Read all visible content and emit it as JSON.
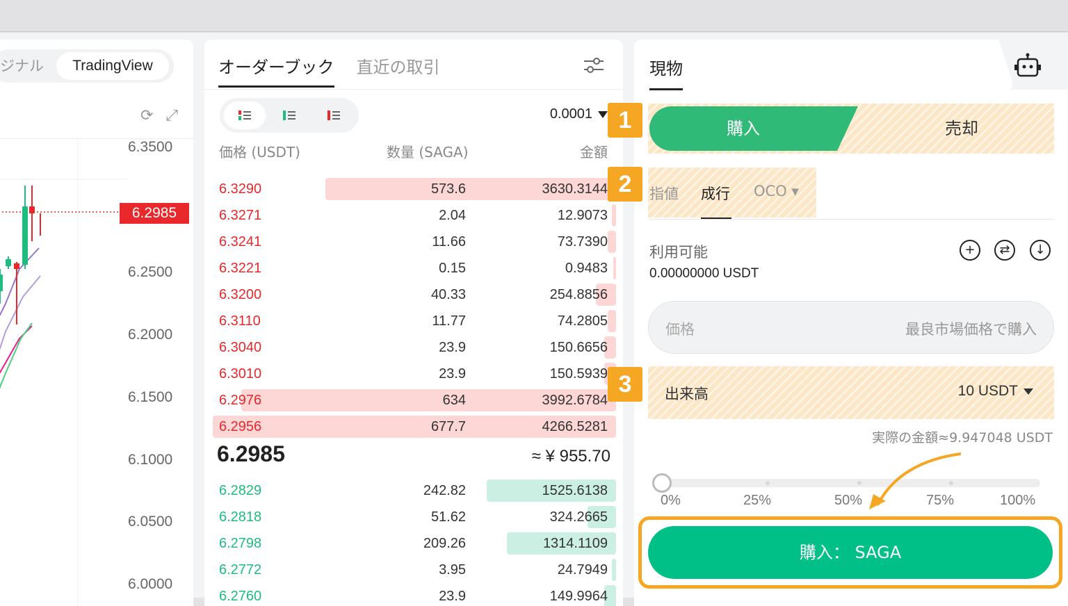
{
  "chart": {
    "view_original": "ジナル",
    "view_tradingview": "TradingView",
    "y_ticks": [
      "6.3500",
      "6.2500",
      "6.2000",
      "6.1500",
      "6.1000",
      "6.0500",
      "6.0000"
    ],
    "current_price_tag": "6.2985",
    "icons": [
      "history-icon",
      "fullscreen-icon"
    ]
  },
  "orderbook": {
    "tabs": [
      "オーダーブック",
      "直近の取引"
    ],
    "precision": "0.0001",
    "headers": {
      "price": "価格 (USDT)",
      "qty": "数量 (SAGA)",
      "amount": "金額"
    },
    "asks": [
      {
        "price": "6.3290",
        "qty": "573.6",
        "amount": "3630.3144",
        "depth": 0.72
      },
      {
        "price": "6.3271",
        "qty": "2.04",
        "amount": "12.9073",
        "depth": 0.01
      },
      {
        "price": "6.3241",
        "qty": "11.66",
        "amount": "73.7390",
        "depth": 0.02
      },
      {
        "price": "6.3221",
        "qty": "0.15",
        "amount": "0.9483",
        "depth": 0.005
      },
      {
        "price": "6.3200",
        "qty": "40.33",
        "amount": "254.8856",
        "depth": 0.05
      },
      {
        "price": "6.3110",
        "qty": "11.77",
        "amount": "74.2805",
        "depth": 0.02
      },
      {
        "price": "6.3040",
        "qty": "23.9",
        "amount": "150.6656",
        "depth": 0.03
      },
      {
        "price": "6.3010",
        "qty": "23.9",
        "amount": "150.5939",
        "depth": 0.03
      },
      {
        "price": "6.2976",
        "qty": "634",
        "amount": "3992.6784",
        "depth": 0.93
      },
      {
        "price": "6.2956",
        "qty": "677.7",
        "amount": "4266.5281",
        "depth": 1.0
      }
    ],
    "last_price": "6.2985",
    "approx_value": "≈ ¥ 955.70",
    "bids": [
      {
        "price": "6.2829",
        "qty": "242.82",
        "amount": "1525.6138",
        "depth": 0.32
      },
      {
        "price": "6.2818",
        "qty": "51.62",
        "amount": "324.2665",
        "depth": 0.07
      },
      {
        "price": "6.2798",
        "qty": "209.26",
        "amount": "1314.1109",
        "depth": 0.27
      },
      {
        "price": "6.2772",
        "qty": "3.95",
        "amount": "24.7949",
        "depth": 0.01
      },
      {
        "price": "6.2760",
        "qty": "23.9",
        "amount": "149.9964",
        "depth": 0.03
      }
    ]
  },
  "trade": {
    "tab": "現物",
    "side_buy": "購入",
    "side_sell": "売却",
    "order_types": [
      "指値",
      "成行",
      "OCO ▾"
    ],
    "available_label": "利用可能",
    "available_value": "0.00000000 USDT",
    "price_label": "価格",
    "price_placeholder": "最良市場価格で購入",
    "volume_label": "出来高",
    "volume_value": "10 USDT",
    "actual_amount": "実際の金額≈9.947048 USDT",
    "slider_value": 0,
    "slider_labels": [
      "0%",
      "25%",
      "50%",
      "75%",
      "100%"
    ],
    "buy_button": "購入： SAGA",
    "badges": [
      "1",
      "2",
      "3"
    ],
    "highlight_color": "#f5a623"
  }
}
